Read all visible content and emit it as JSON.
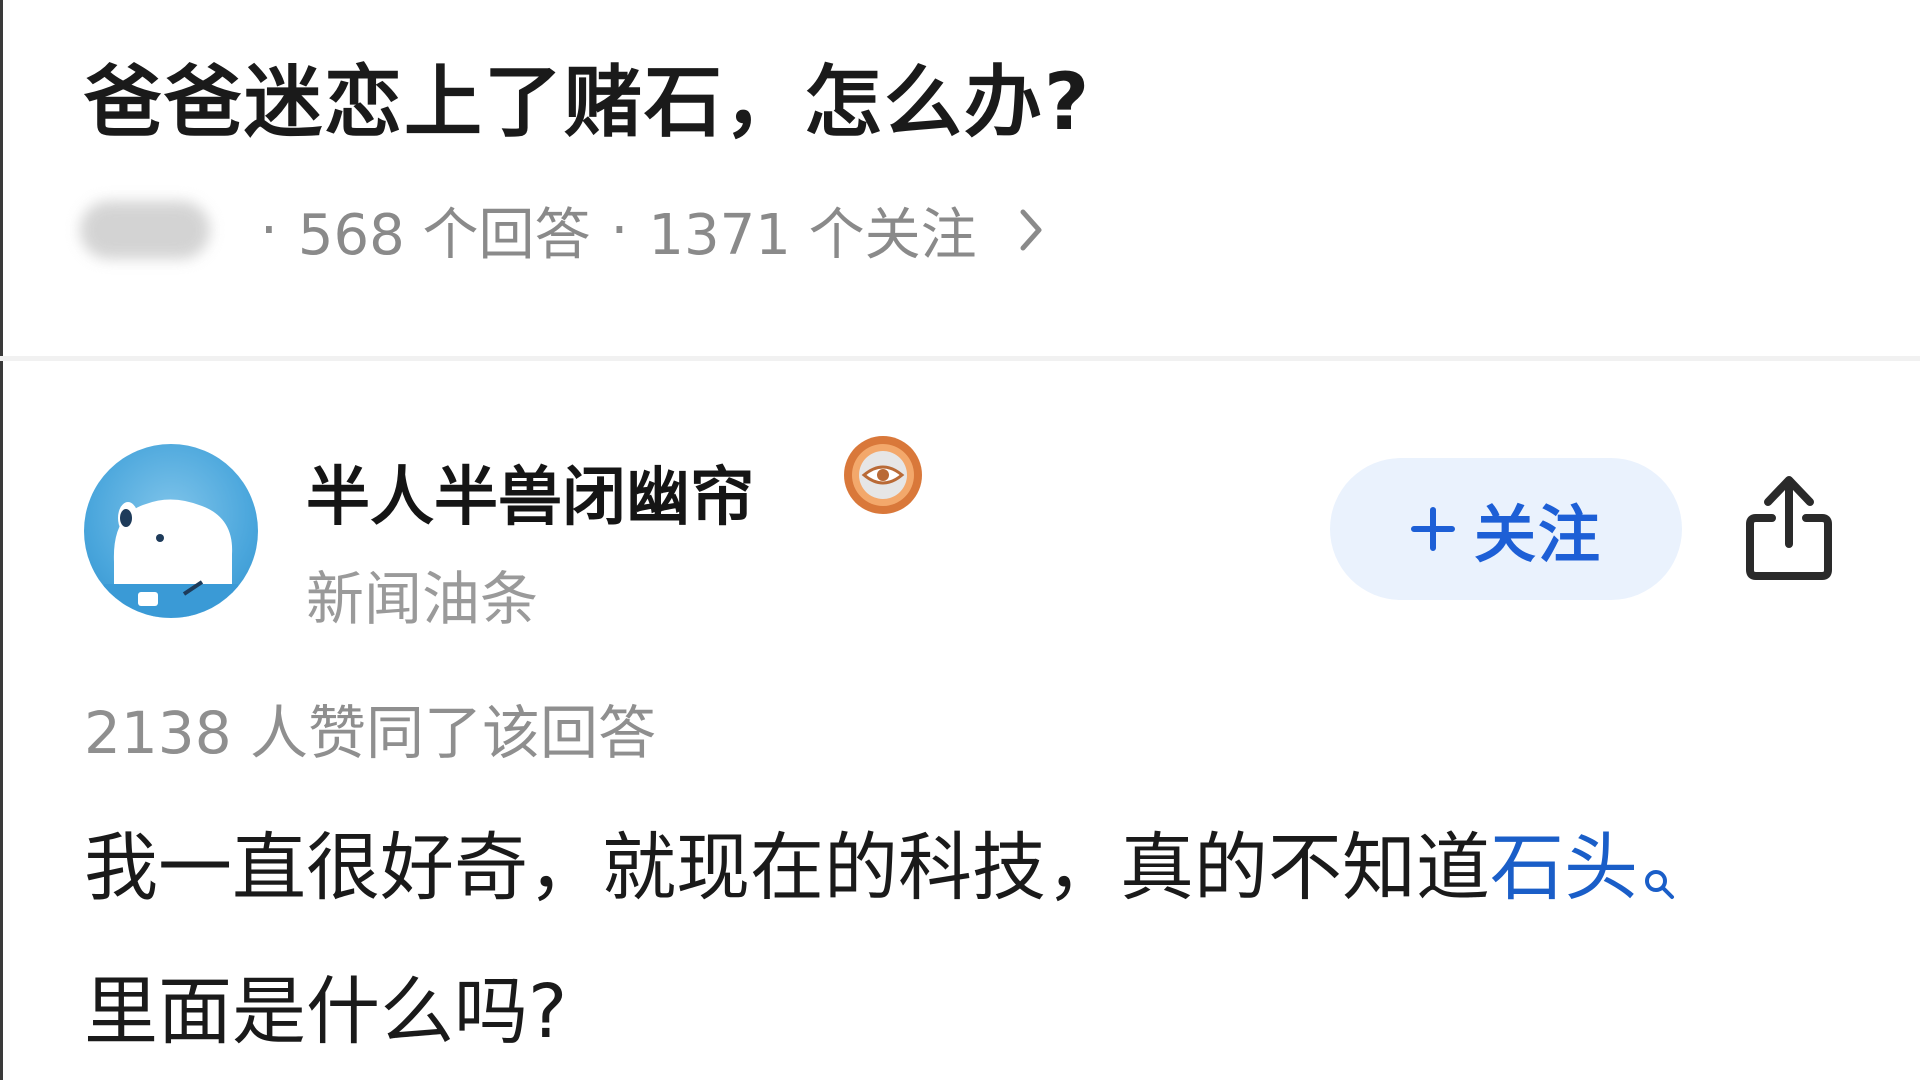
{
  "question": {
    "title": "爸爸迷恋上了赌石，怎么办?",
    "answers_count": "568 个回答",
    "followers_count": "1371 个关注",
    "separator": "·"
  },
  "answer": {
    "author": {
      "name": "半人半兽闭幽帘",
      "tagline": "新闻油条",
      "avatar_icon": "dog-avatar-icon",
      "badge_icon": "eye-badge-icon"
    },
    "follow_button": {
      "plus": "+",
      "label": "关注"
    },
    "share_icon": "share-icon",
    "upvote_text": "2138 人赞同了该回答",
    "body_part1": "我一直很好奇，就现在的科技，真的不知道",
    "body_link": "石头",
    "body_part2": "里面是什么吗?"
  },
  "colors": {
    "link": "#1a5ec8",
    "follow_bg": "#eaf2fd",
    "follow_text": "#1d5fd6",
    "meta_text": "#8a8a8a",
    "badge_orange": "#d9783a"
  }
}
